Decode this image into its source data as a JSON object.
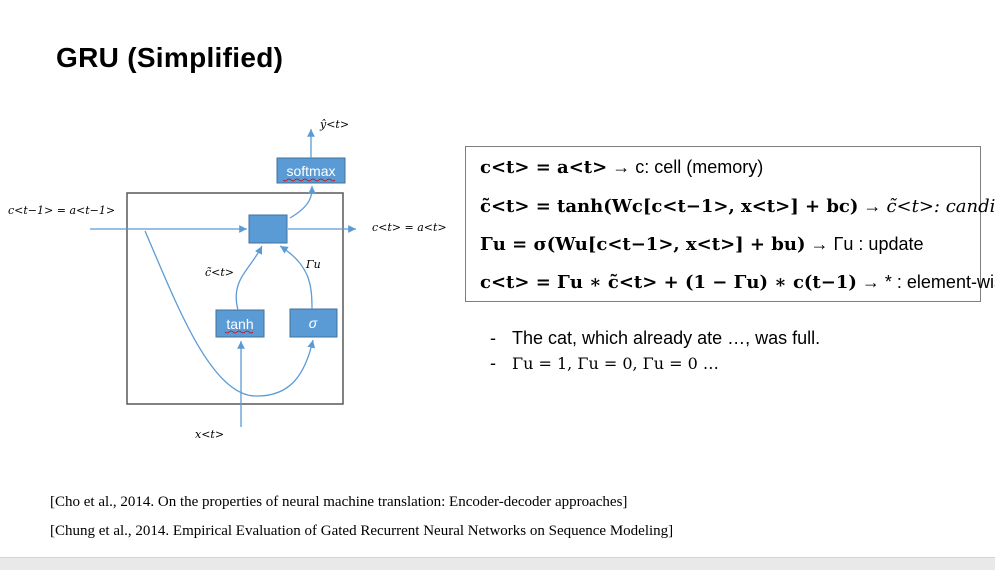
{
  "slide": {
    "title": "GRU  (Simplified)",
    "diagram": {
      "softmax_label": "softmax",
      "tanh_label": "tanh",
      "sigma_label": "σ",
      "y_hat_label": "ŷ<t>",
      "c_prev_label": "c<t−1> = a<t−1>",
      "c_out_label": "c<t> = a<t>",
      "c_tilde_label": "c̃<t>",
      "gamma_u_label": "Γu",
      "x_label": "x<t>"
    },
    "equations": {
      "eq1_lhs": "c<t> = a<t>",
      "eq1_desc": "c: cell (memory)",
      "eq2_lhs": "c̃<t> = tanh(Wc[c<t−1>, x<t>] + bc)",
      "eq2_desc": "c̃<t>: candidate",
      "eq3_lhs": "Γu = σ(Wu[c<t−1>, x<t>] + bu)",
      "eq3_desc": "Γu : update",
      "eq4_lhs": "c<t> = Γu ∗ c̃<t> + (1 − Γu) ∗ c(t−1)",
      "eq4_desc": "* : element-wise"
    },
    "bullets": [
      "The cat, which already ate …, was full.",
      "Γu = 1, Γu = 0, Γu = 0 …"
    ],
    "references": [
      "[Cho et al., 2014. On the properties of neural machine translation: Encoder-decoder approaches]",
      "[Chung et al., 2014. Empirical Evaluation of Gated Recurrent Neural Networks on Sequence Modeling]"
    ],
    "colors": {
      "box_fill": "#5b9bd5",
      "box_stroke": "#41719c",
      "wire": "#5b9bd5"
    }
  }
}
